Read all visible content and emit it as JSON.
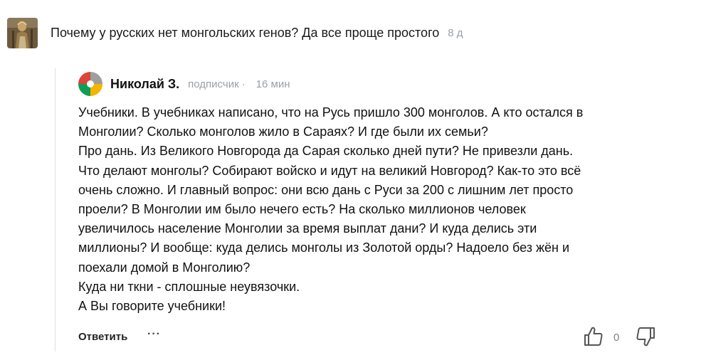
{
  "post": {
    "title": "Почему у русских нет монгольских генов? Да все проще простого",
    "age": "8 д",
    "thumbnail_icon": "article-thumbnail-image"
  },
  "comment": {
    "author": "Николай З.",
    "role": "подписчик",
    "separator": "·",
    "time": "16 мин",
    "avatar_icon": "colorful-pinwheel-avatar",
    "avatar_colors": [
      "#f4b400",
      "#db4437",
      "#0f9d58",
      "#9e9e9e"
    ],
    "body_lines": [
      "Учебники. В учебниках написано, что на Русь пришло 300 монголов. А кто остался в",
      "Монголии? Сколько монголов жило в Сараях? И где были их семьи?",
      "Про дань. Из Великого Новгорода да Сарая сколько дней пути? Не привезли дань.",
      "Что делают монголы? Собирают войско и идут на великий Новгород? Как-то это всё",
      "очень сложно. И главный вопрос: они всю дань с Руси за 200 с лишним лет просто",
      "проели? В Монголии им было нечего есть? На сколько миллионов человек",
      "увеличилось население Монголии за время выплат дани? И куда делись эти",
      "миллионы? И вообще: куда делись монголы из Золотой орды? Надоело без жён и",
      "поехали домой в Монголию?",
      "Куда ни ткни - сплошные неувязочки.",
      "А Вы говорите учебники!"
    ]
  },
  "actions": {
    "reply_label": "Ответить",
    "more_label": "···",
    "like_count": "0",
    "like_icon": "thumbs-up-icon",
    "dislike_icon": "thumbs-down-icon"
  }
}
